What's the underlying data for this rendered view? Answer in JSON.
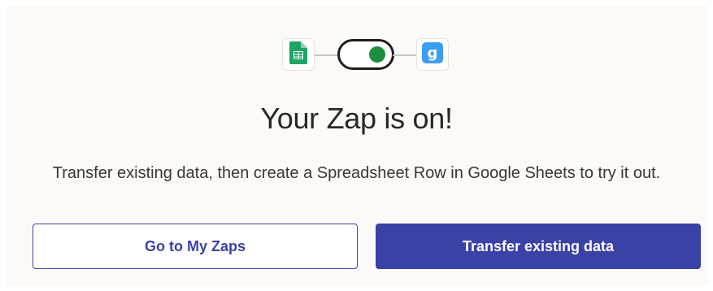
{
  "hero": {
    "left_app_icon": "google-sheets-icon",
    "toggle_state": "on",
    "right_app_icon": "gmail-style-g-icon",
    "right_app_glyph": "g"
  },
  "main": {
    "title": "Your Zap is on!",
    "subtitle": "Transfer existing data, then create a Spreadsheet Row in Google Sheets to try it out."
  },
  "actions": {
    "secondary_label": "Go to My Zaps",
    "primary_label": "Transfer existing data"
  },
  "colors": {
    "primary": "#3b42a6",
    "toggle_on": "#1e8e3e",
    "sheets_green": "#1fa463",
    "right_app_blue": "#3b9ef5"
  }
}
